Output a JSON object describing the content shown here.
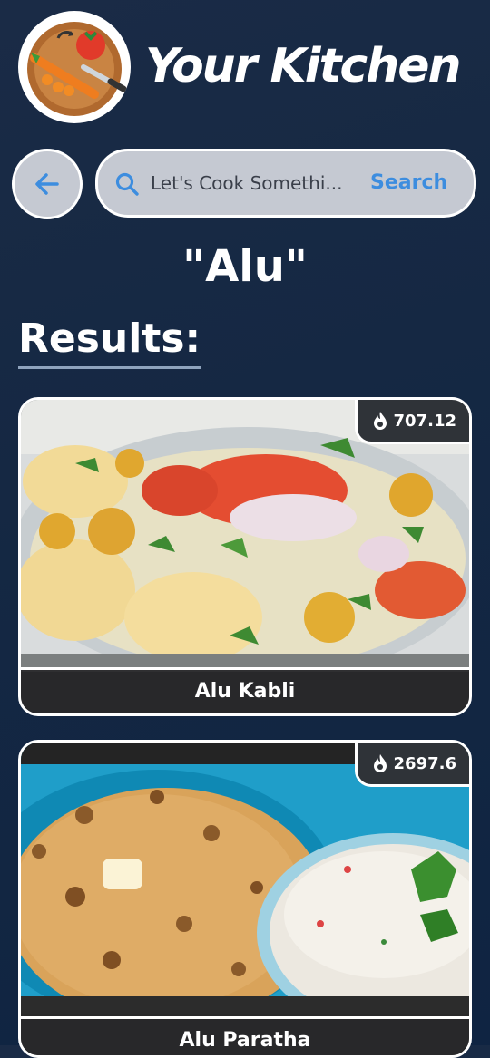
{
  "header": {
    "app_title": "Your Kitchen",
    "logo_icon": "cutting-board-vegetables-icon"
  },
  "search": {
    "back_icon": "arrow-left-icon",
    "search_icon": "magnifier-icon",
    "placeholder": "Let's Cook Somethi...",
    "button_label": "Search"
  },
  "query": {
    "title": "\"Alu\""
  },
  "results": {
    "heading": "Results:",
    "items": [
      {
        "name": "Alu Kabli",
        "calories": "707.12",
        "calorie_icon": "flame-icon"
      },
      {
        "name": "Alu Paratha",
        "calories": "2697.6",
        "calorie_icon": "flame-icon"
      }
    ]
  },
  "colors": {
    "background_top": "#1a2b46",
    "background_bottom": "#0f2442",
    "search_bar": "#c5c9d2",
    "accent_blue": "#3d8ddf",
    "badge_bg": "#2f3338"
  }
}
